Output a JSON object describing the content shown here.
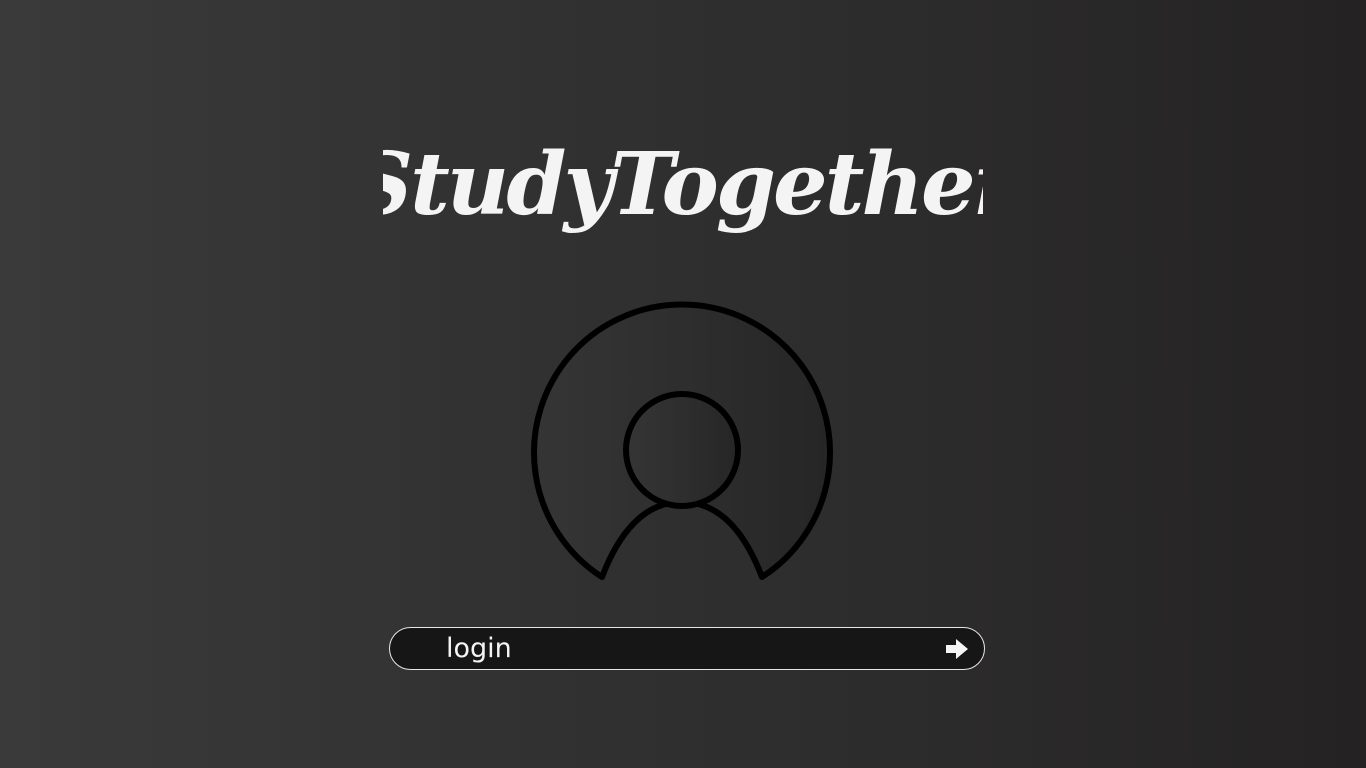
{
  "app": {
    "logo_text": "StudyTogether"
  },
  "avatar": {
    "icon": "user-avatar-icon"
  },
  "login": {
    "placeholder": "login",
    "submit_icon": "arrow-right-icon"
  },
  "colors": {
    "background_left": "#3a3a3a",
    "background_right": "#242222",
    "field_background": "#161616",
    "field_border": "#e6e6e6",
    "text": "#f4f4f4",
    "icon_stroke": "#000000"
  }
}
